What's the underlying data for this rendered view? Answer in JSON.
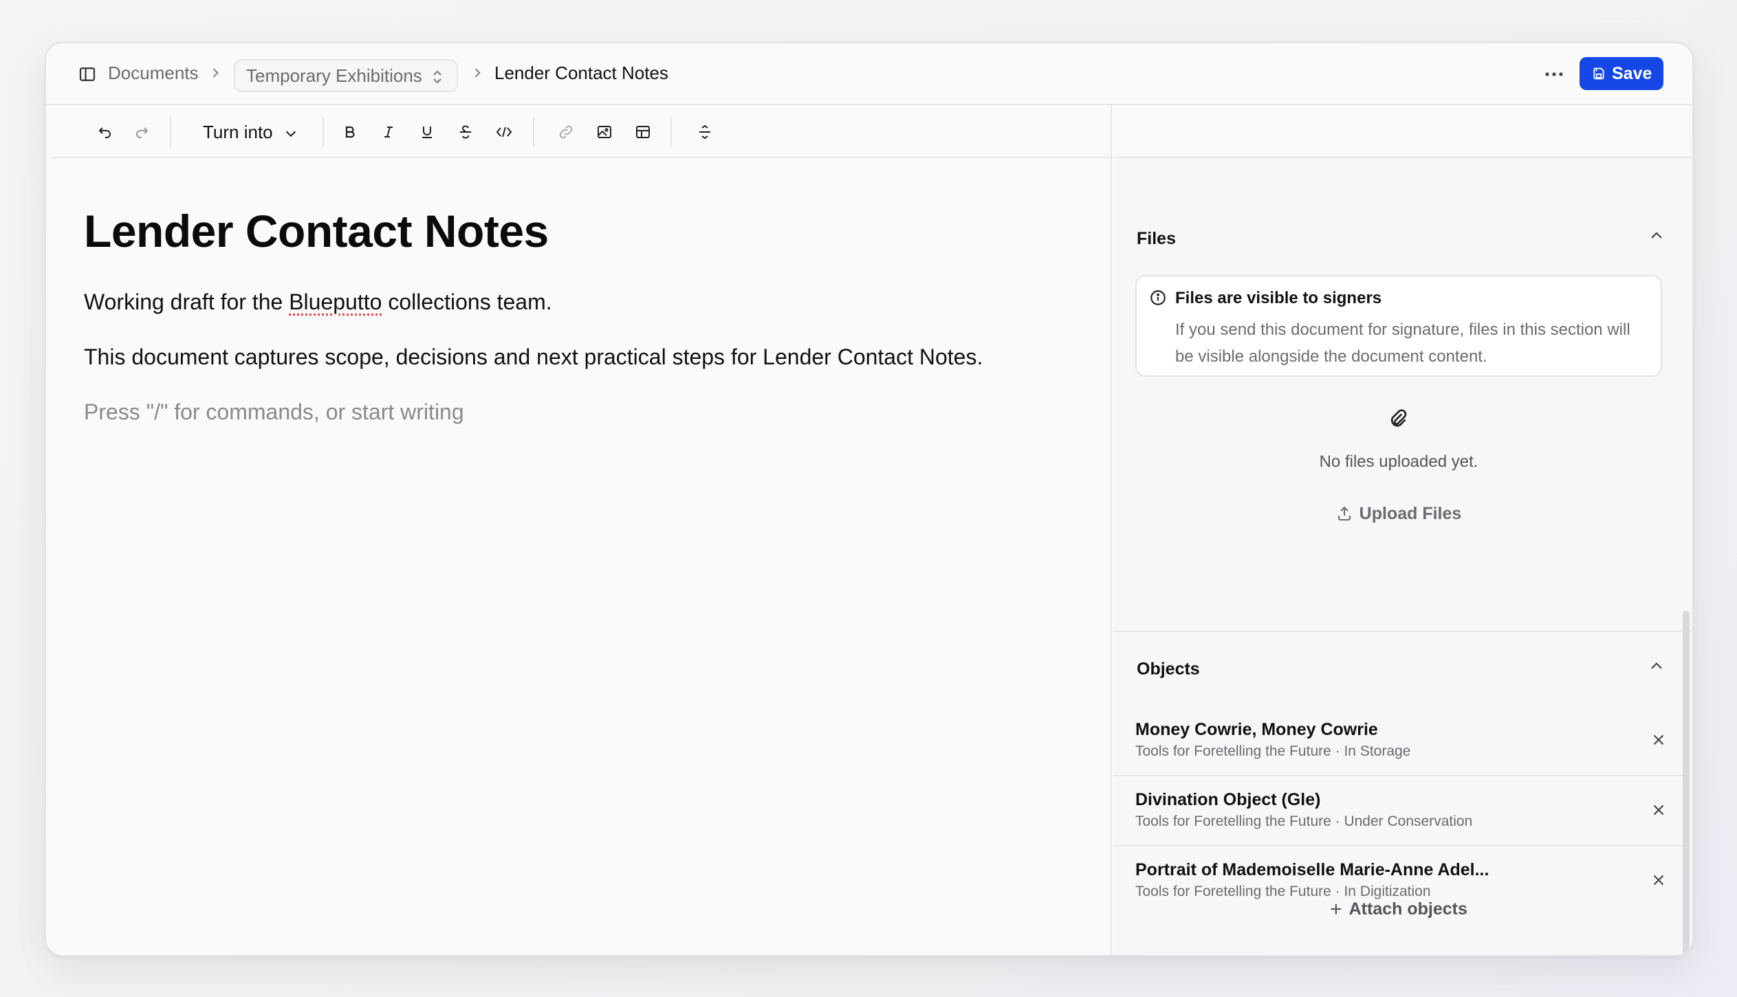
{
  "header": {
    "breadcrumb_root": "Documents",
    "breadcrumb_folder": "Temporary Exhibitions",
    "breadcrumb_current": "Lender Contact Notes",
    "save_label": "Save"
  },
  "toolbar": {
    "turn_into_label": "Turn into",
    "icons": [
      "undo-icon",
      "redo-icon",
      "bold-icon",
      "italic-icon",
      "underline-icon",
      "strikethrough-icon",
      "code-icon",
      "link-icon",
      "image-icon",
      "table-icon",
      "divider-icon"
    ]
  },
  "document": {
    "title": "Lender Contact Notes",
    "para1_before": "Working draft for the ",
    "para1_misspelled": "Blueputto",
    "para1_after": " collections team.",
    "para2": "This document captures scope, decisions and next practical steps for Lender Contact Notes.",
    "placeholder": "Press \"/\" for commands, or start writing"
  },
  "files": {
    "title": "Files",
    "notice_title": "Files are visible to signers",
    "notice_text": "If you send this document for signature, files in this section will be visible alongside the document content.",
    "empty_text": "No files uploaded yet.",
    "upload_label": "Upload Files"
  },
  "objects": {
    "title": "Objects",
    "items": [
      {
        "name": "Money Cowrie, Money Cowrie",
        "meta": "Tools for Foretelling the Future · In Storage"
      },
      {
        "name": "Divination Object (Gle)",
        "meta": "Tools for Foretelling the Future · Under Conservation"
      },
      {
        "name": "Portrait of Mademoiselle Marie-Anne Adel...",
        "meta": "Tools for Foretelling the Future · In Digitization"
      }
    ],
    "attach_label": "Attach objects"
  },
  "colors": {
    "accent": "#1447e6",
    "muted_text": "#6b6b70"
  }
}
